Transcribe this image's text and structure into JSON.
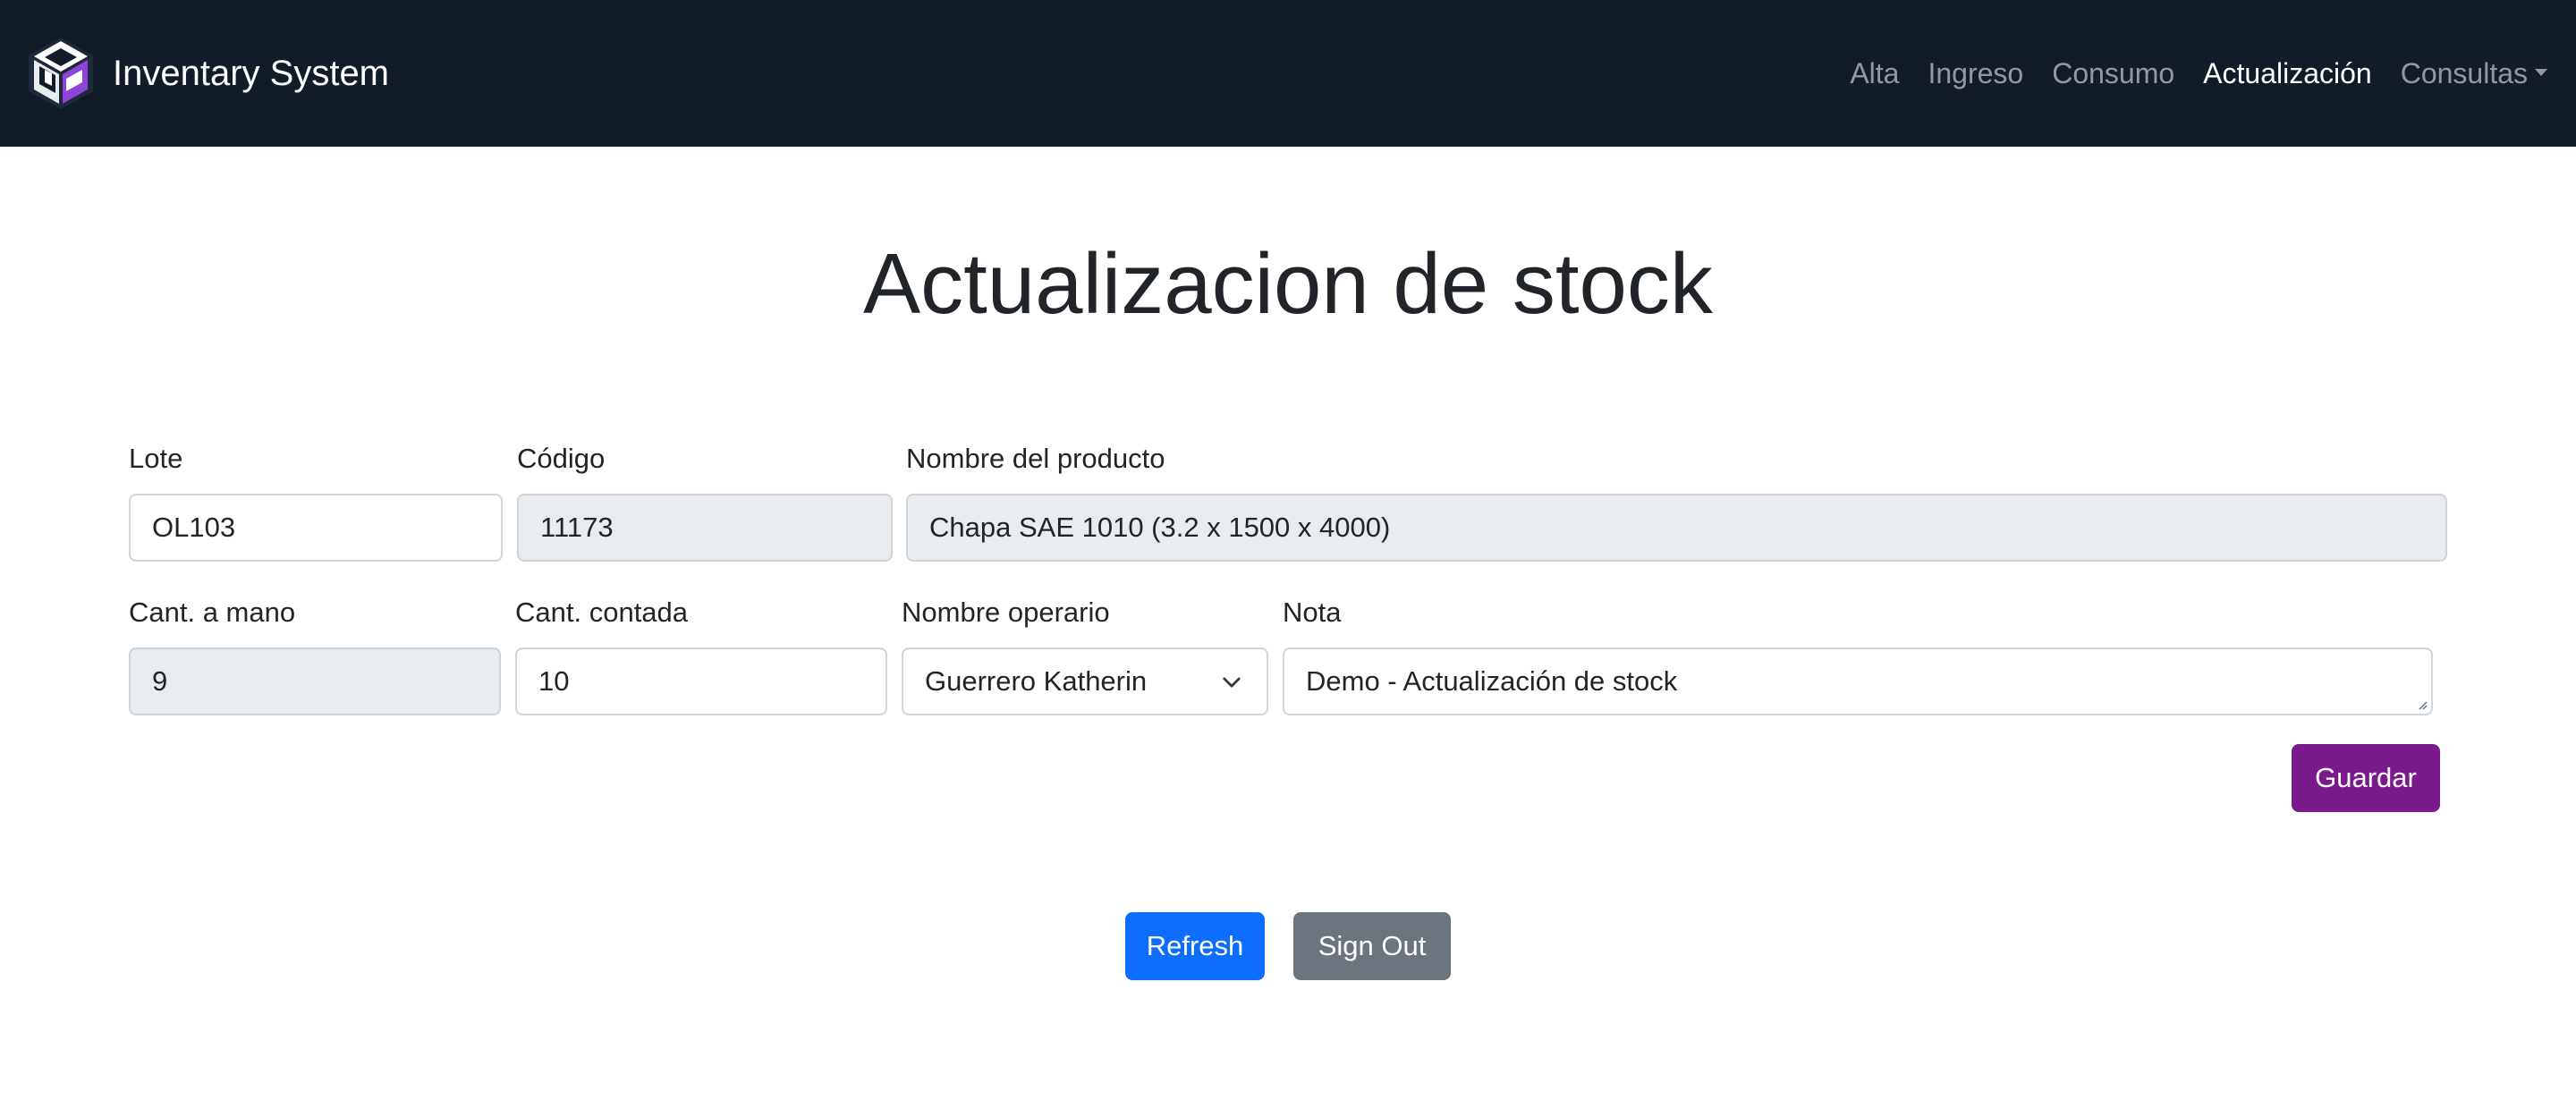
{
  "navbar": {
    "brand": "Inventary System",
    "links": [
      {
        "label": "Alta",
        "active": false
      },
      {
        "label": "Ingreso",
        "active": false
      },
      {
        "label": "Consumo",
        "active": false
      },
      {
        "label": "Actualización",
        "active": true
      },
      {
        "label": "Consultas",
        "active": false,
        "dropdown": true
      }
    ]
  },
  "page": {
    "title": "Actualizacion de stock"
  },
  "form": {
    "lote": {
      "label": "Lote",
      "value": "OL103"
    },
    "codigo": {
      "label": "Código",
      "value": "11173"
    },
    "nombre_producto": {
      "label": "Nombre del producto",
      "value": "Chapa SAE 1010 (3.2 x 1500 x 4000)"
    },
    "cant_a_mano": {
      "label": "Cant. a mano",
      "value": "9"
    },
    "cant_contada": {
      "label": "Cant. contada",
      "value": "10"
    },
    "nombre_operario": {
      "label": "Nombre operario",
      "value": "Guerrero Katherin"
    },
    "nota": {
      "label": "Nota",
      "value": "Demo - Actualización de stock"
    },
    "save_label": "Guardar"
  },
  "actions": {
    "refresh_label": "Refresh",
    "signout_label": "Sign Out"
  },
  "colors": {
    "navbar_bg": "#121c28",
    "guardar": "#7a1a8c",
    "refresh": "#0d6efd",
    "signout": "#6c757d",
    "disabled_field": "#e9ecef"
  },
  "icons": {
    "brand": "cube-logo-icon",
    "select": "chevron-down-icon",
    "dropdown": "caret-down-icon"
  }
}
